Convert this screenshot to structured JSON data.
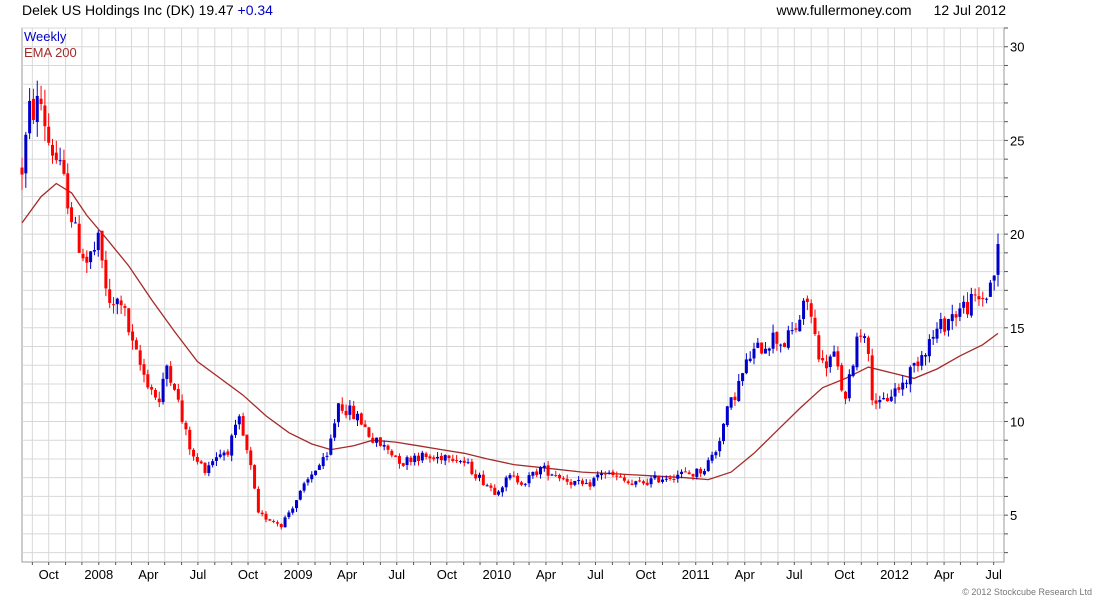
{
  "header": {
    "title": "Delek US Holdings Inc (DK) 19.47",
    "change": "+0.34",
    "site": "www.fullermoney.com",
    "date": "12 Jul 2012"
  },
  "legend": {
    "weekly": "Weekly",
    "ema": "EMA 200"
  },
  "copyright": "© 2012 Stockcube Research Ltd",
  "colors": {
    "up": "#0000cc",
    "down": "#ff0000",
    "ema": "#a52a2a",
    "grid": "#d8d8d8"
  },
  "chart_data": {
    "type": "candlestick",
    "title": "Delek US Holdings Inc (DK) 19.47 +0.34",
    "frequency": "Weekly",
    "overlay": "EMA 200",
    "yticks": [
      5,
      10,
      15,
      20,
      25,
      30
    ],
    "ylim": [
      2.5,
      31
    ],
    "xlim": [
      "2007-08-13",
      "2012-07-20"
    ],
    "scale": "linear",
    "grid": true,
    "legend": "top-left",
    "xticks": [
      {
        "label": "Oct",
        "date": "2007-10-01"
      },
      {
        "label": "2008",
        "date": "2008-01-01"
      },
      {
        "label": "Apr",
        "date": "2008-04-01"
      },
      {
        "label": "Jul",
        "date": "2008-07-01"
      },
      {
        "label": "Oct",
        "date": "2008-10-01"
      },
      {
        "label": "2009",
        "date": "2009-01-01"
      },
      {
        "label": "Apr",
        "date": "2009-04-01"
      },
      {
        "label": "Jul",
        "date": "2009-07-01"
      },
      {
        "label": "Oct",
        "date": "2009-10-01"
      },
      {
        "label": "2010",
        "date": "2010-01-01"
      },
      {
        "label": "Apr",
        "date": "2010-04-01"
      },
      {
        "label": "Jul",
        "date": "2010-07-01"
      },
      {
        "label": "Oct",
        "date": "2010-10-01"
      },
      {
        "label": "2011",
        "date": "2011-01-01"
      },
      {
        "label": "Apr",
        "date": "2011-04-01"
      },
      {
        "label": "Jul",
        "date": "2011-07-01"
      },
      {
        "label": "Oct",
        "date": "2011-10-01"
      },
      {
        "label": "2012",
        "date": "2012-01-01"
      },
      {
        "label": "Apr",
        "date": "2012-04-01"
      },
      {
        "label": "Jul",
        "date": "2012-07-01"
      }
    ],
    "price_path": [
      [
        "2007-08-13",
        23.5
      ],
      [
        "2007-08-27",
        26.5
      ],
      [
        "2007-09-17",
        27.0
      ],
      [
        "2007-10-01",
        25.0
      ],
      [
        "2007-10-15",
        24.0
      ],
      [
        "2007-11-05",
        22.0
      ],
      [
        "2007-11-19",
        20.0
      ],
      [
        "2007-12-10",
        18.5
      ],
      [
        "2008-01-01",
        19.5
      ],
      [
        "2008-01-21",
        16.0
      ],
      [
        "2008-02-11",
        16.5
      ],
      [
        "2008-03-03",
        14.0
      ],
      [
        "2008-03-24",
        12.5
      ],
      [
        "2008-04-21",
        11.0
      ],
      [
        "2008-05-05",
        13.0
      ],
      [
        "2008-05-19",
        12.0
      ],
      [
        "2008-06-02",
        10.0
      ],
      [
        "2008-06-23",
        8.0
      ],
      [
        "2008-07-14",
        7.5
      ],
      [
        "2008-08-04",
        8.2
      ],
      [
        "2008-08-25",
        8.5
      ],
      [
        "2008-09-15",
        10.0
      ],
      [
        "2008-10-06",
        7.5
      ],
      [
        "2008-10-20",
        5.0
      ],
      [
        "2008-11-10",
        4.8
      ],
      [
        "2008-12-01",
        4.5
      ],
      [
        "2008-12-22",
        5.5
      ],
      [
        "2009-01-12",
        6.5
      ],
      [
        "2009-02-02",
        7.5
      ],
      [
        "2009-02-23",
        8.0
      ],
      [
        "2009-03-16",
        11.0
      ],
      [
        "2009-04-06",
        10.5
      ],
      [
        "2009-04-27",
        10.0
      ],
      [
        "2009-05-18",
        9.0
      ],
      [
        "2009-06-15",
        8.5
      ],
      [
        "2009-07-13",
        7.8
      ],
      [
        "2009-08-03",
        8.2
      ],
      [
        "2009-09-07",
        8.0
      ],
      [
        "2009-10-05",
        8.3
      ],
      [
        "2009-11-02",
        7.8
      ],
      [
        "2009-11-30",
        7.0
      ],
      [
        "2009-12-28",
        6.3
      ],
      [
        "2010-01-25",
        7.0
      ],
      [
        "2010-02-22",
        6.8
      ],
      [
        "2010-03-22",
        7.5
      ],
      [
        "2010-04-19",
        7.2
      ],
      [
        "2010-05-17",
        6.8
      ],
      [
        "2010-06-14",
        6.5
      ],
      [
        "2010-07-12",
        7.3
      ],
      [
        "2010-08-09",
        7.0
      ],
      [
        "2010-09-06",
        6.6
      ],
      [
        "2010-10-04",
        6.8
      ],
      [
        "2010-11-01",
        7.0
      ],
      [
        "2010-11-29",
        7.2
      ],
      [
        "2010-12-27",
        7.2
      ],
      [
        "2011-01-17",
        7.5
      ],
      [
        "2011-02-07",
        8.5
      ],
      [
        "2011-02-28",
        10.5
      ],
      [
        "2011-03-21",
        12.0
      ],
      [
        "2011-04-11",
        13.5
      ],
      [
        "2011-05-02",
        14.0
      ],
      [
        "2011-05-23",
        14.5
      ],
      [
        "2011-06-13",
        14.2
      ],
      [
        "2011-07-04",
        15.0
      ],
      [
        "2011-07-25",
        16.5
      ],
      [
        "2011-08-08",
        14.5
      ],
      [
        "2011-08-22",
        13.0
      ],
      [
        "2011-09-12",
        13.5
      ],
      [
        "2011-10-03",
        11.0
      ],
      [
        "2011-10-24",
        14.5
      ],
      [
        "2011-11-07",
        15.0
      ],
      [
        "2011-11-21",
        11.5
      ],
      [
        "2011-12-05",
        10.8
      ],
      [
        "2011-12-26",
        11.5
      ],
      [
        "2012-01-16",
        12.0
      ],
      [
        "2012-02-06",
        13.0
      ],
      [
        "2012-02-27",
        14.0
      ],
      [
        "2012-03-19",
        14.8
      ],
      [
        "2012-04-09",
        15.5
      ],
      [
        "2012-04-30",
        16.0
      ],
      [
        "2012-05-21",
        16.3
      ],
      [
        "2012-06-04",
        16.5
      ],
      [
        "2012-06-18",
        16.8
      ],
      [
        "2012-07-02",
        18.0
      ],
      [
        "2012-07-09",
        19.47
      ]
    ],
    "ema200": [
      [
        "2007-08-13",
        20.6
      ],
      [
        "2007-09-17",
        22.0
      ],
      [
        "2007-10-15",
        22.7
      ],
      [
        "2007-11-12",
        22.2
      ],
      [
        "2007-12-10",
        21.0
      ],
      [
        "2008-01-14",
        19.8
      ],
      [
        "2008-02-25",
        18.3
      ],
      [
        "2008-04-07",
        16.5
      ],
      [
        "2008-05-19",
        14.8
      ],
      [
        "2008-06-30",
        13.2
      ],
      [
        "2008-08-11",
        12.3
      ],
      [
        "2008-09-22",
        11.4
      ],
      [
        "2008-11-03",
        10.3
      ],
      [
        "2008-12-15",
        9.4
      ],
      [
        "2009-01-26",
        8.8
      ],
      [
        "2009-03-02",
        8.5
      ],
      [
        "2009-04-13",
        8.7
      ],
      [
        "2009-05-18",
        9.0
      ],
      [
        "2009-06-29",
        8.9
      ],
      [
        "2009-08-10",
        8.7
      ],
      [
        "2009-09-21",
        8.5
      ],
      [
        "2009-11-02",
        8.3
      ],
      [
        "2009-12-14",
        8.0
      ],
      [
        "2010-02-01",
        7.7
      ],
      [
        "2010-04-05",
        7.5
      ],
      [
        "2010-06-07",
        7.3
      ],
      [
        "2010-08-09",
        7.2
      ],
      [
        "2010-10-11",
        7.1
      ],
      [
        "2010-12-13",
        7.0
      ],
      [
        "2011-01-24",
        6.9
      ],
      [
        "2011-03-07",
        7.3
      ],
      [
        "2011-04-18",
        8.3
      ],
      [
        "2011-05-30",
        9.5
      ],
      [
        "2011-07-11",
        10.7
      ],
      [
        "2011-08-22",
        11.8
      ],
      [
        "2011-10-03",
        12.3
      ],
      [
        "2011-11-14",
        12.9
      ],
      [
        "2011-12-26",
        12.6
      ],
      [
        "2012-02-06",
        12.3
      ],
      [
        "2012-03-19",
        12.8
      ],
      [
        "2012-04-30",
        13.5
      ],
      [
        "2012-06-11",
        14.1
      ],
      [
        "2012-07-09",
        14.7
      ]
    ]
  }
}
